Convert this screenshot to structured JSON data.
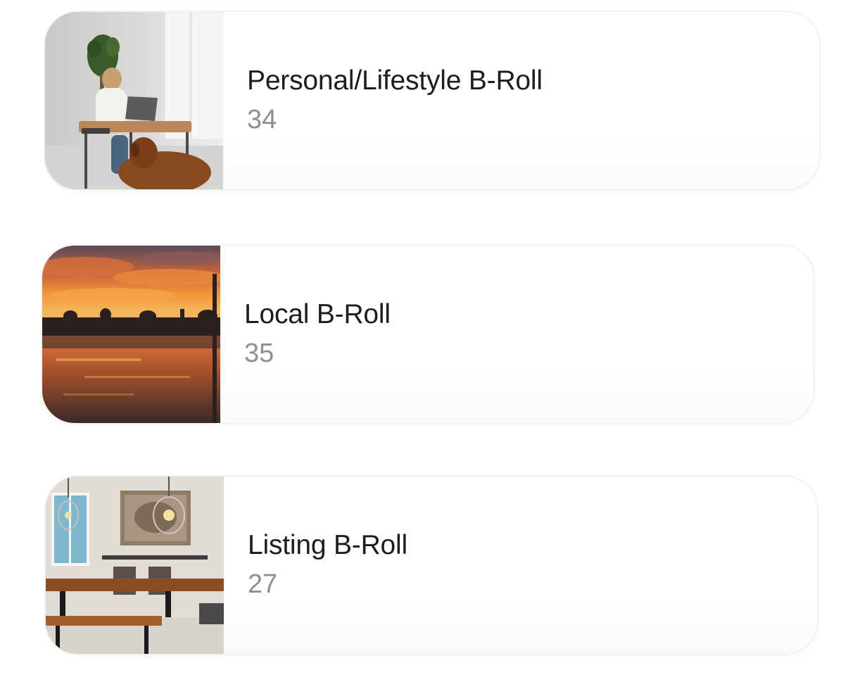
{
  "albums": [
    {
      "title": "Personal/Lifestyle B-Roll",
      "count": "34",
      "thumbnail_icon": "home-office-photo"
    },
    {
      "title": "Local B-Roll",
      "count": "35",
      "thumbnail_icon": "sunset-waterfront-photo"
    },
    {
      "title": "Listing B-Roll",
      "count": "27",
      "thumbnail_icon": "dining-room-photo"
    }
  ],
  "colors": {
    "card_background": "#ffffff",
    "card_border": "#f1efe6",
    "title_text": "#1d1d1f",
    "count_text": "#8e8e93"
  }
}
